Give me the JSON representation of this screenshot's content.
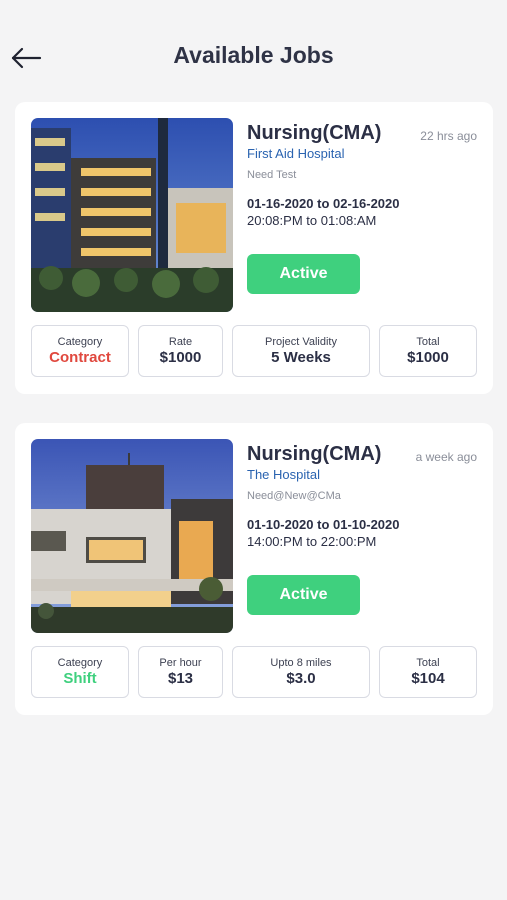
{
  "header": {
    "title": "Available Jobs",
    "back_icon": "arrow-left-icon"
  },
  "jobs": [
    {
      "title": "Nursing(CMA)",
      "time_ago": "22 hrs ago",
      "hospital": "First Aid Hospital",
      "note": "Need Test",
      "date_range": "01-16-2020 to 02-16-2020",
      "time_range": "20:08:PM to 01:08:AM",
      "status": "Active",
      "stats": [
        {
          "label": "Category",
          "value": "Contract",
          "color": "#e0483e"
        },
        {
          "label": "Rate",
          "value": "$1000",
          "color": "#2b2f45"
        },
        {
          "label": "Project Validity",
          "value": "5 Weeks",
          "color": "#2b2f45"
        },
        {
          "label": "Total",
          "value": "$1000",
          "color": "#2b2f45"
        }
      ]
    },
    {
      "title": "Nursing(CMA)",
      "time_ago": "a week ago",
      "hospital": "The Hospital",
      "note": "Need@New@CMa",
      "date_range": "01-10-2020 to 01-10-2020",
      "time_range": "14:00:PM to 22:00:PM",
      "status": "Active",
      "stats": [
        {
          "label": "Category",
          "value": "Shift",
          "color": "#3fd07e"
        },
        {
          "label": "Per hour",
          "value": "$13",
          "color": "#2b2f45"
        },
        {
          "label": "Upto 8 miles",
          "value": "$3.0",
          "color": "#2b2f45"
        },
        {
          "label": "Total",
          "value": "$104",
          "color": "#2b2f45"
        }
      ]
    }
  ],
  "colors": {
    "accent_green": "#3fd07e",
    "contract_red": "#e0483e",
    "link_blue": "#2a63b0"
  }
}
